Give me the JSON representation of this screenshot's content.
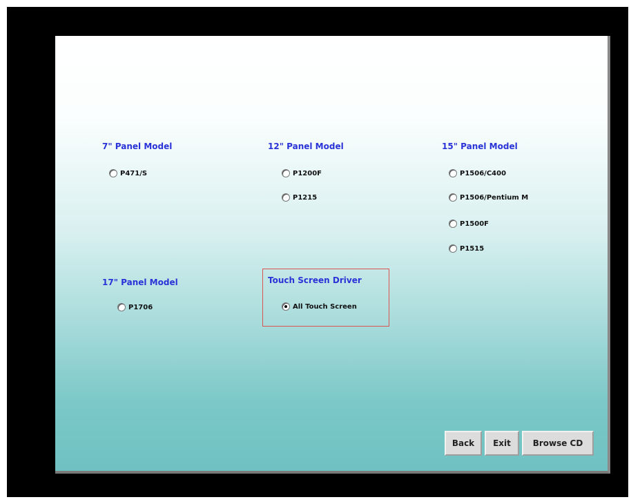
{
  "sections": {
    "panel7": {
      "title": "7\" Panel Model",
      "options": [
        "P471/S"
      ]
    },
    "panel12": {
      "title": "12\" Panel Model",
      "options": [
        "P1200F",
        "P1215"
      ]
    },
    "panel15": {
      "title": "15\" Panel Model",
      "options": [
        "P1506/C400",
        "P1506/Pentium M",
        "P1500F",
        "P1515"
      ]
    },
    "panel17": {
      "title": "17\" Panel Model",
      "options": [
        "P1706"
      ]
    },
    "driver": {
      "title": "Touch Screen Driver",
      "options": [
        "All Touch Screen"
      ],
      "selected": "All Touch Screen"
    }
  },
  "buttons": {
    "back": "Back",
    "exit": "Exit",
    "browse": "Browse CD"
  },
  "colors": {
    "section_title": "#2a33d8",
    "highlight_box": "#d9534f"
  }
}
